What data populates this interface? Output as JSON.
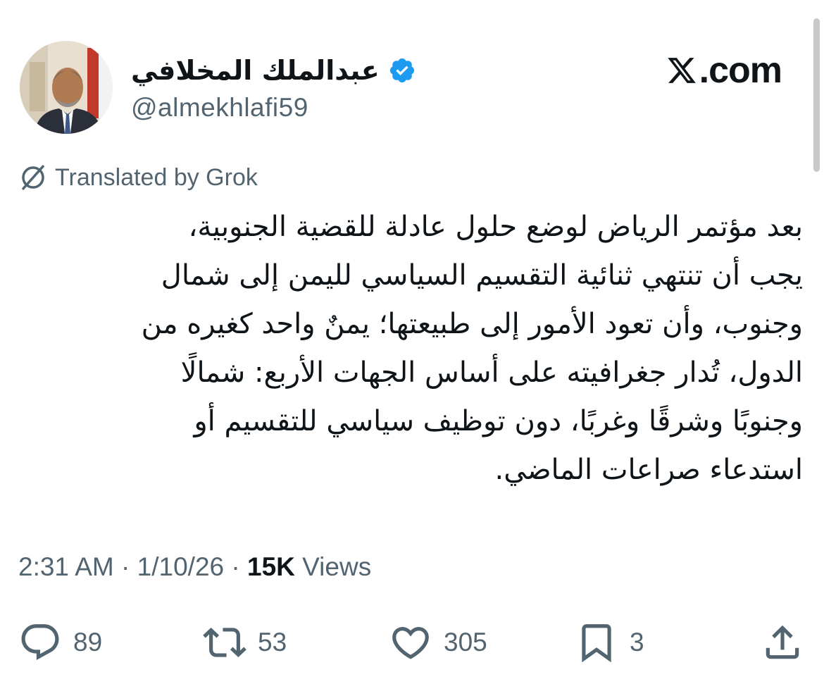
{
  "author": {
    "display_name": "عبدالملك المخلافي",
    "handle": "@almekhlafi59",
    "verified": true,
    "avatar_icon": "profile-photo"
  },
  "brand": {
    "logo_icon": "x-logo-icon",
    "text": ".com"
  },
  "translation": {
    "label": "Translated by Grok",
    "icon": "translate-icon"
  },
  "tweet": {
    "lines": [
      "بعد مؤتمر الرياض لوضع حلول عادلة للقضية الجنوبية،",
      "يجب أن تنتهي ثنائية التقسيم السياسي لليمن إلى شمال",
      "وجنوب، وأن تعود الأمور إلى طبيعتها؛ يمنٌ واحد كغيره من",
      "الدول، تُدار جغرافيته على أساس الجهات الأربع: شمالًا",
      "وجنوبًا وشرقًا وغربًا، دون توظيف سياسي للتقسيم أو",
      "استدعاء صراعات الماضي."
    ]
  },
  "meta": {
    "time": "2:31 AM",
    "separator": " · ",
    "date": "1/10/26",
    "views_count": "15K",
    "views_label": " Views"
  },
  "actions": {
    "replies": "89",
    "reposts": "53",
    "likes": "305",
    "bookmarks": "3"
  },
  "colors": {
    "text_primary": "#0f1419",
    "text_secondary": "#536471",
    "verified_blue": "#1d9bf0"
  }
}
